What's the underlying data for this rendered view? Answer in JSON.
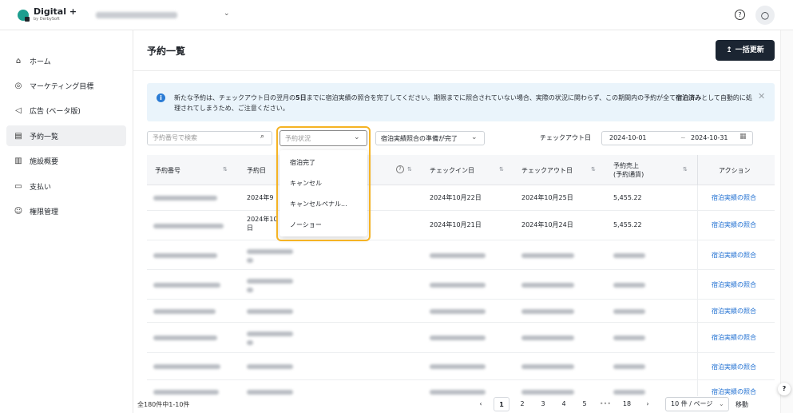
{
  "header": {
    "app_name": "Digital +",
    "app_sub": "by DerbySoft",
    "help_glyph": "?",
    "avatar_glyph": "○",
    "chevron": "⌄"
  },
  "sidebar": {
    "items": [
      {
        "label": "ホーム",
        "icon": "home-icon",
        "glyph": "⌂"
      },
      {
        "label": "マーケティング目標",
        "icon": "target-icon",
        "glyph": "◎"
      },
      {
        "label": "広告 (ベータ版)",
        "icon": "megaphone-icon",
        "glyph": "◁"
      },
      {
        "label": "予約一覧",
        "icon": "list-icon",
        "glyph": "▤"
      },
      {
        "label": "施設概要",
        "icon": "building-icon",
        "glyph": "▥"
      },
      {
        "label": "支払い",
        "icon": "wallet-icon",
        "glyph": "▭"
      },
      {
        "label": "権限管理",
        "icon": "user-key-icon",
        "glyph": "☺"
      }
    ],
    "active_index": 3
  },
  "page": {
    "title": "予約一覧",
    "bulk_update_label": "一括更新",
    "bulk_update_icon": "↥"
  },
  "notice": {
    "icon_glyph": "i",
    "text_part1": "新たな予約は、チェックアウト日の翌月の",
    "text_bold1": "5日",
    "text_part2": "までに宿泊実績の照合を完了してください。期限までに照合されていない場合、実際の状況に関わらず、この期間内の予約が全て",
    "text_bold2": "宿泊済み",
    "text_part3": "として自動的に処理されてしまうため、ご注意ください。",
    "close_glyph": "✕"
  },
  "filters": {
    "search_placeholder": "予約番号で検索",
    "search_glyph": "⌕",
    "status_placeholder": "予約状況",
    "ready_value": "宿泊実績照合の準備が完了",
    "checkout_label": "チェックアウト日",
    "date_from": "2024-10-01",
    "date_sep": "~",
    "date_to": "2024-10-31",
    "calendar_glyph": "▦",
    "chevron": "⌄"
  },
  "status_dropdown": {
    "options": [
      "宿泊完了",
      "キャンセル",
      "キャンセルペナル...",
      "ノーショー"
    ]
  },
  "table": {
    "columns": {
      "booking_no": "予約番号",
      "booking_date": "予約日",
      "checkin": "チェックイン日",
      "checkout": "チェックアウト日",
      "revenue_line1": "予約売上",
      "revenue_line2": "(予約通貨)",
      "action": "アクション"
    },
    "sort_glyph": "⇅",
    "help_glyph": "?",
    "rows": [
      {
        "booking_date": "2024年9",
        "checkin": "2024年10月22日",
        "checkout": "2024年10月25日",
        "revenue": "5,455.22",
        "action": "宿泊実績の照合"
      },
      {
        "booking_date": "2024年10",
        "booking_date_2": "日",
        "checkin": "2024年10月21日",
        "checkout": "2024年10月24日",
        "revenue": "5,455.22",
        "action": "宿泊実績の照合"
      },
      {
        "action": "宿泊実績の照合"
      },
      {
        "action": "宿泊実績の照合"
      },
      {
        "action": "宿泊実績の照合"
      },
      {
        "action": "宿泊実績の照合"
      },
      {
        "action": "宿泊実績の照合"
      },
      {
        "action": "宿泊実績の照合"
      }
    ]
  },
  "pagination": {
    "total_text": "全180件中1-10件",
    "prev_glyph": "‹",
    "next_glyph": "›",
    "pages": [
      "1",
      "2",
      "3",
      "4",
      "5",
      "•••",
      "18"
    ],
    "active_page": "1",
    "per_page": "10 件 / ページ",
    "goto_label": "移動"
  },
  "floating_help": "?"
}
